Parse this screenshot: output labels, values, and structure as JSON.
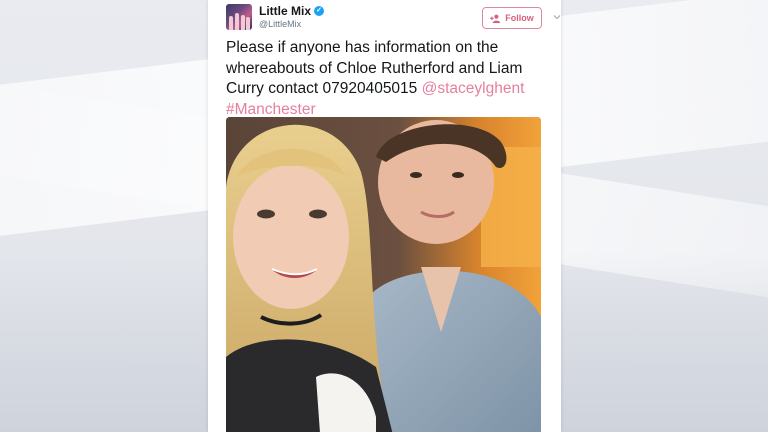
{
  "account": {
    "display_name": "Little Mix",
    "handle": "@LittleMix",
    "verified_icon": "verified-badge-icon",
    "follow_label": "Follow",
    "accent_color": "#e57f9c"
  },
  "tweet": {
    "text": "Please if anyone has information on the whereabouts of Chloe Rutherford and Liam Curry contact 07920405015 ",
    "mention": "@staceylghent",
    "hashtag": "#Manchester"
  },
  "media": {
    "photo_icon": "photo"
  }
}
